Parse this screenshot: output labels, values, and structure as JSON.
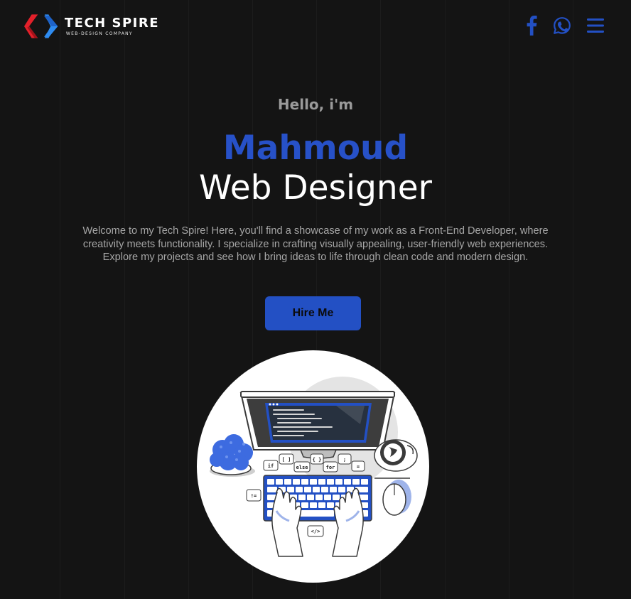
{
  "brand": {
    "name": "TECH SPIRE",
    "tagline": "WEB-DESIGN COMPANY"
  },
  "nav": {
    "icons": [
      "facebook-icon",
      "whatsapp-icon",
      "hamburger-menu-icon"
    ]
  },
  "hero": {
    "greeting": "Hello, i'm",
    "name": "Mahmoud",
    "role": "Web Designer",
    "intro": "Welcome to my Tech Spire! Here, you'll find a showcase of my work as a Front-End Developer, where creativity meets functionality. I specialize in crafting visually appealing, user-friendly web experiences. Explore my projects and see how I bring ideas to life through clean code and modern design.",
    "cta_label": "Hire Me"
  },
  "illustration": {
    "keywords": [
      "if",
      "[ ]",
      "else",
      "{ }",
      "for",
      ";",
      "=",
      "!=",
      "</>"
    ]
  },
  "colors": {
    "background": "#141414",
    "accent": "#2350c4",
    "logo_red": "#e3202a",
    "logo_blue": "#2e8bf0"
  }
}
